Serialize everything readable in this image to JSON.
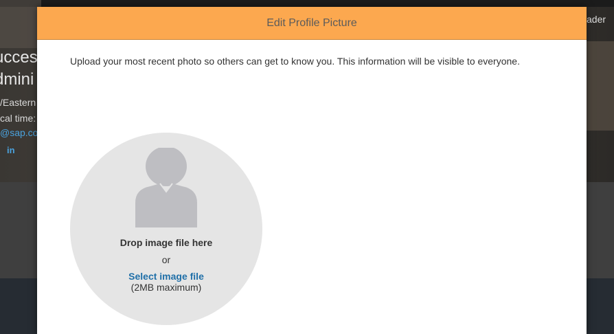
{
  "background": {
    "name_line1": "ucces",
    "name_line2": "dmini",
    "timezone": "/Eastern",
    "local_time_label": "cal time:",
    "email": "@sap.co",
    "linkedin": "in",
    "header_right": "ader"
  },
  "modal": {
    "title": "Edit Profile Picture",
    "description": "Upload your most recent photo so others can get to know you. This information will be visible to everyone.",
    "drop_zone": {
      "drop_text": "Drop image file here",
      "or_text": "or",
      "select_link": "Select image file",
      "size_hint": "(2MB maximum)"
    }
  },
  "colors": {
    "header_orange": "#fca84f",
    "link_blue": "#1f6fa8",
    "drop_zone_bg": "#e5e5e5",
    "avatar_gray": "#bebec2"
  },
  "icons": {
    "avatar": "person-silhouette-icon",
    "linkedin": "linkedin-icon"
  }
}
